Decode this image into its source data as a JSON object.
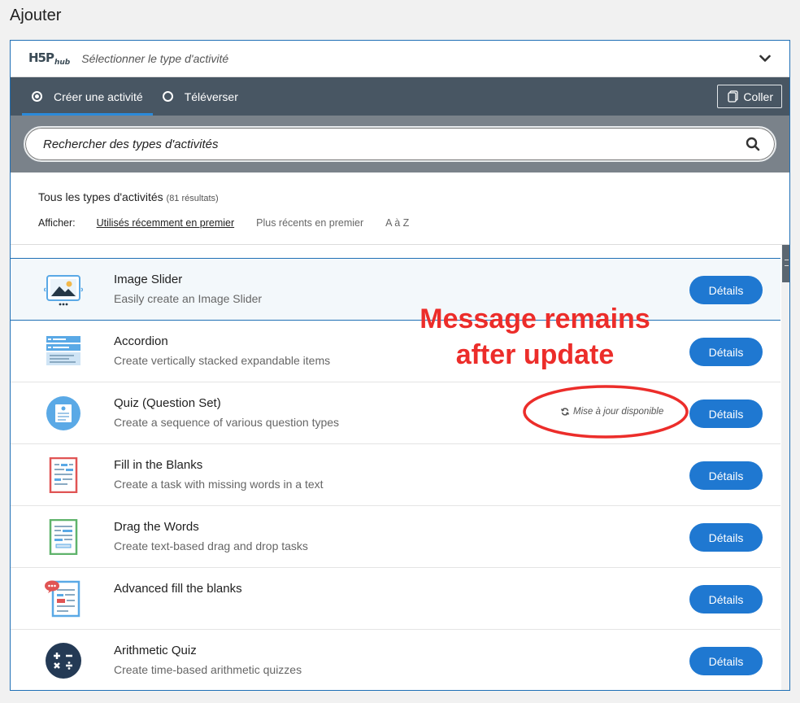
{
  "page": {
    "heading": "Ajouter"
  },
  "hub": {
    "logo": "H5P",
    "logo_sub": "hub",
    "title": "Sélectionner le type d'activité"
  },
  "tabs": [
    {
      "label": "Créer une activité",
      "active": true
    },
    {
      "label": "Téléverser",
      "active": false
    }
  ],
  "paste_button": {
    "label": "Coller"
  },
  "search": {
    "placeholder": "Rechercher des types d'activités"
  },
  "filter": {
    "results_label": "Tous les types d'activités",
    "results_count": "(81 résultats)",
    "sort_label": "Afficher:",
    "sort_options": [
      {
        "label": "Utilisés récemment en premier",
        "active": true
      },
      {
        "label": "Plus récents en premier",
        "active": false
      },
      {
        "label": "A à Z",
        "active": false
      }
    ]
  },
  "items": [
    {
      "title": "Image Slider",
      "desc": "Easily create an Image Slider",
      "button": "Détails",
      "icon": "image-slider-icon"
    },
    {
      "title": "Accordion",
      "desc": "Create vertically stacked expandable items",
      "button": "Détails",
      "icon": "accordion-icon"
    },
    {
      "title": "Quiz (Question Set)",
      "desc": "Create a sequence of various question types",
      "button": "Détails",
      "icon": "quiz-icon",
      "update": "Mise à jour disponible"
    },
    {
      "title": "Fill in the Blanks",
      "desc": "Create a task with missing words in a text",
      "button": "Détails",
      "icon": "fill-blanks-icon"
    },
    {
      "title": "Drag the Words",
      "desc": "Create text-based drag and drop tasks",
      "button": "Détails",
      "icon": "drag-words-icon"
    },
    {
      "title": "Advanced fill the blanks",
      "desc": "",
      "button": "Détails",
      "icon": "advanced-blanks-icon"
    },
    {
      "title": "Arithmetic Quiz",
      "desc": "Create time-based arithmetic quizzes",
      "button": "Détails",
      "icon": "arithmetic-icon"
    }
  ],
  "annotation": {
    "line1": "Message remains",
    "line2": "after update",
    "color": "#ec2d2a"
  },
  "colors": {
    "accent": "#1f78d1",
    "tabbar": "#485663",
    "searchbar": "#7a828a"
  }
}
